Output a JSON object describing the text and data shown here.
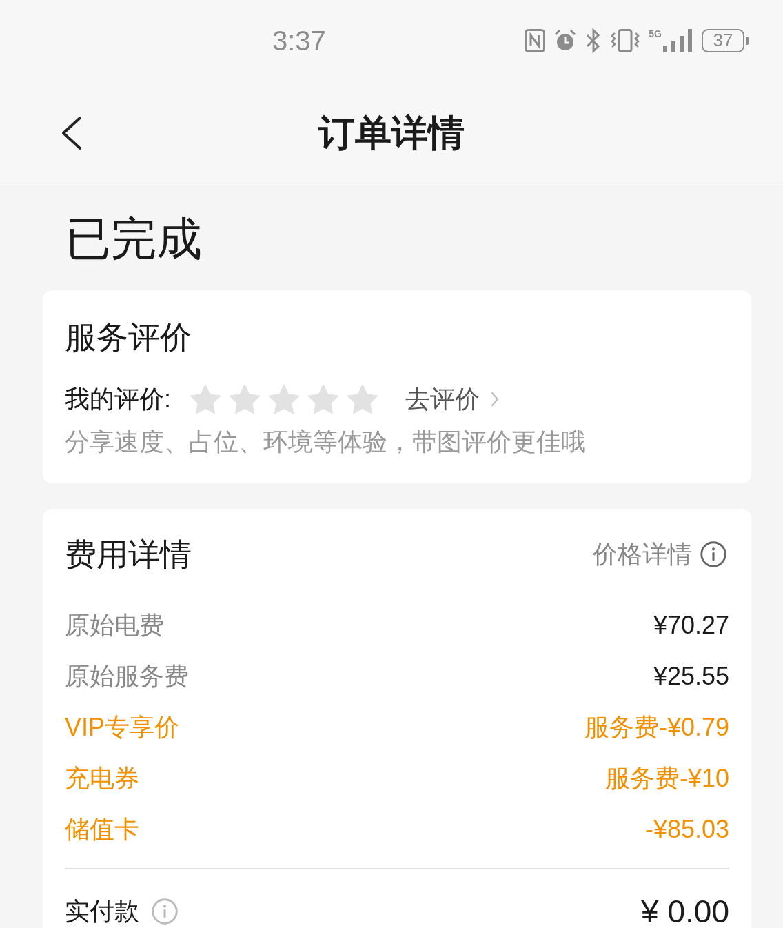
{
  "status_bar": {
    "time": "3:37",
    "network": "5G",
    "battery": "37"
  },
  "nav": {
    "title": "订单详情"
  },
  "order_status": "已完成",
  "rating_card": {
    "title": "服务评价",
    "label": "我的评价:",
    "stars": 0,
    "action": "去评价",
    "hint": "分享速度、占位、环境等体验，带图评价更佳哦"
  },
  "fee_card": {
    "title": "费用详情",
    "link": "价格详情",
    "items": [
      {
        "label": "原始电费",
        "value": "¥70.27",
        "kind": "original"
      },
      {
        "label": "原始服务费",
        "value": "¥25.55",
        "kind": "original"
      },
      {
        "label": "VIP专享价",
        "value": "服务费-¥0.79",
        "kind": "discount"
      },
      {
        "label": "充电券",
        "value": "服务费-¥10",
        "kind": "discount"
      },
      {
        "label": "储值卡",
        "value": "-¥85.03",
        "kind": "discount"
      }
    ],
    "total": {
      "label": "实付款",
      "value": "¥ 0.00"
    }
  }
}
